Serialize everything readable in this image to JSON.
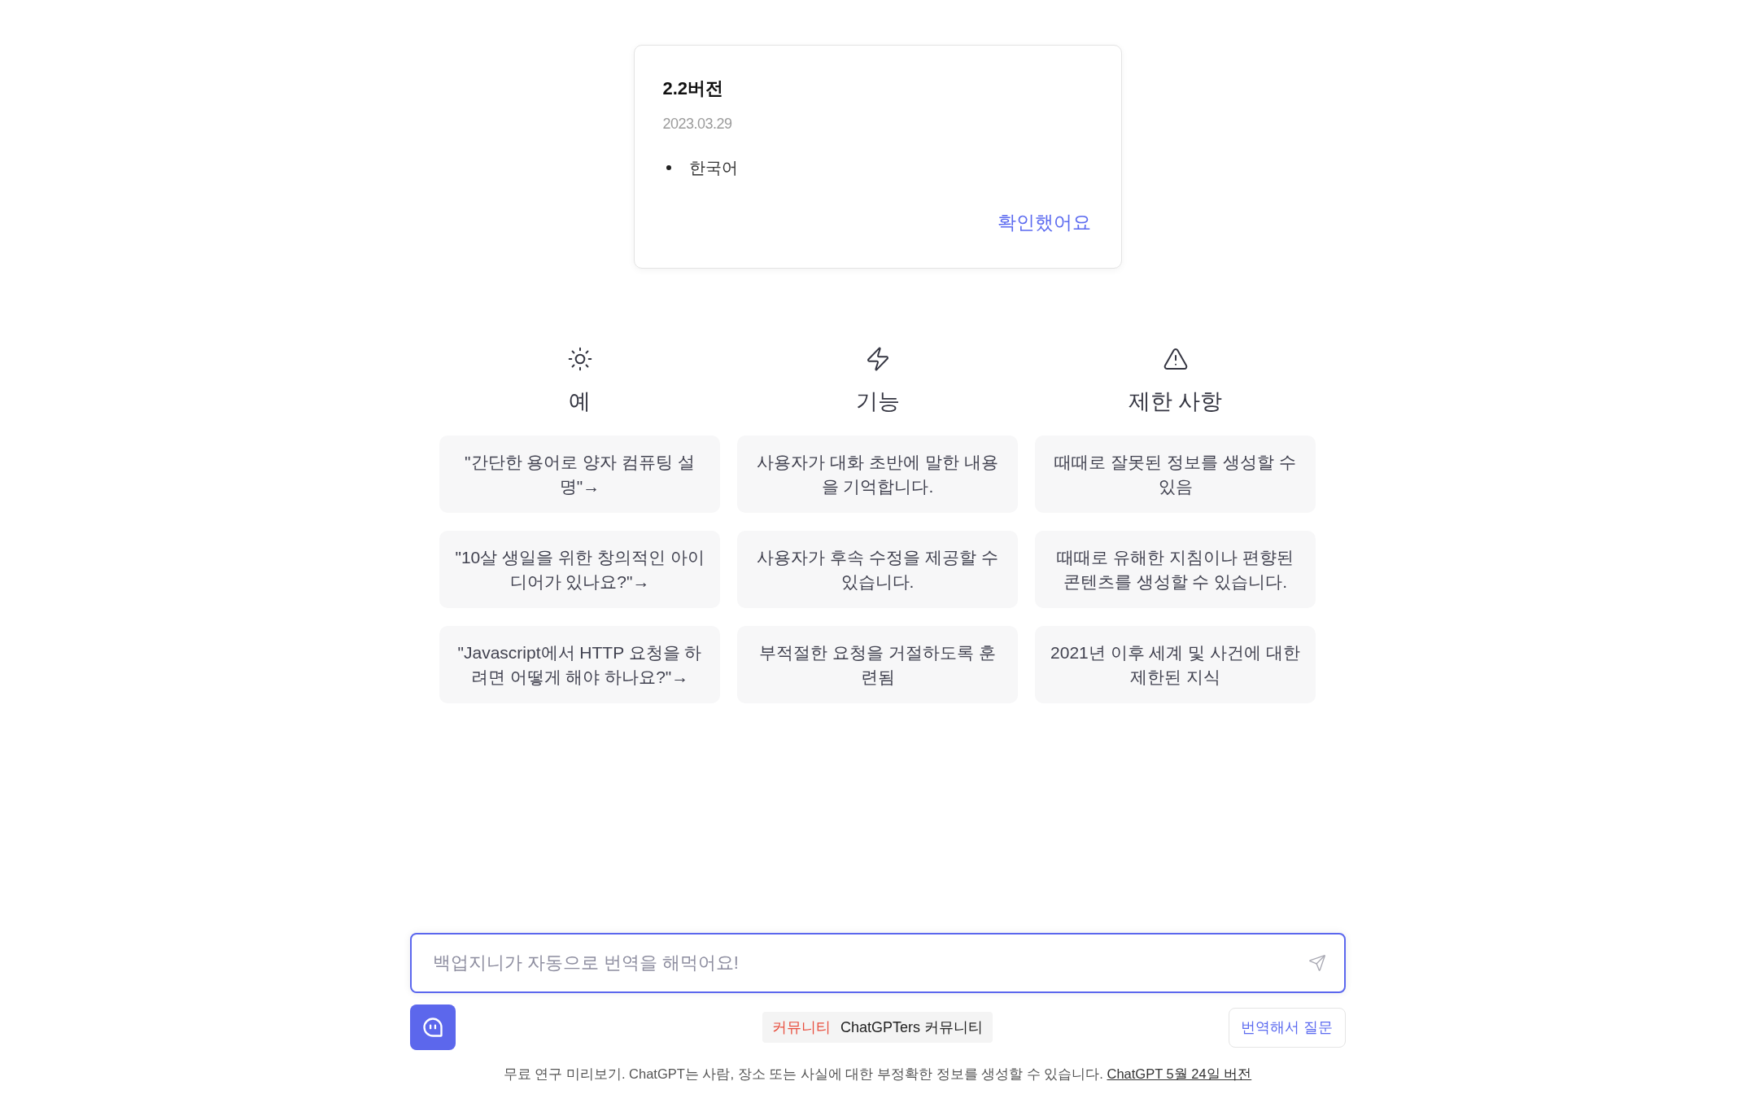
{
  "update_notice": {
    "title": "2.2버전",
    "date": "2023.03.29",
    "items": [
      "한국어"
    ],
    "confirm_button": "확인했어요"
  },
  "columns": [
    {
      "kind": "examples",
      "heading": "예",
      "items": [
        "\"간단한 용어로 양자 컴퓨팅 설명\"→",
        "\"10살 생일을 위한 창의적인 아이디어가 있나요?\"→",
        "\"Javascript에서 HTTP 요청을 하려면 어떻게 해야 하나요?\"→"
      ]
    },
    {
      "kind": "capabilities",
      "heading": "기능",
      "items": [
        "사용자가 대화 초반에 말한 내용을 기억합니다.",
        "사용자가 후속 수정을 제공할 수 있습니다.",
        "부적절한 요청을 거절하도록 훈련됨"
      ]
    },
    {
      "kind": "limitations",
      "heading": "제한 사항",
      "items": [
        "때때로 잘못된 정보를 생성할 수 있음",
        "때때로 유해한 지침이나 편향된 콘텐츠를 생성할 수 있습니다.",
        "2021년 이후 세계 및 사건에 대한 제한된 지식"
      ]
    }
  ],
  "message_input": {
    "placeholder": "백업지니가 자동으로 번역을 해먹어요!"
  },
  "toolbar": {
    "community_tag": {
      "label": "커뮤니티",
      "text": "ChatGPTers 커뮤니티"
    },
    "translate_button": "번역해서 질문"
  },
  "footer": {
    "text": "무료 연구 미리보기. ChatGPT는 사람, 장소 또는 사실에 대한 부정확한 정보를 생성할 수 있습니다.",
    "link": "ChatGPT 5월 24일 버전"
  }
}
